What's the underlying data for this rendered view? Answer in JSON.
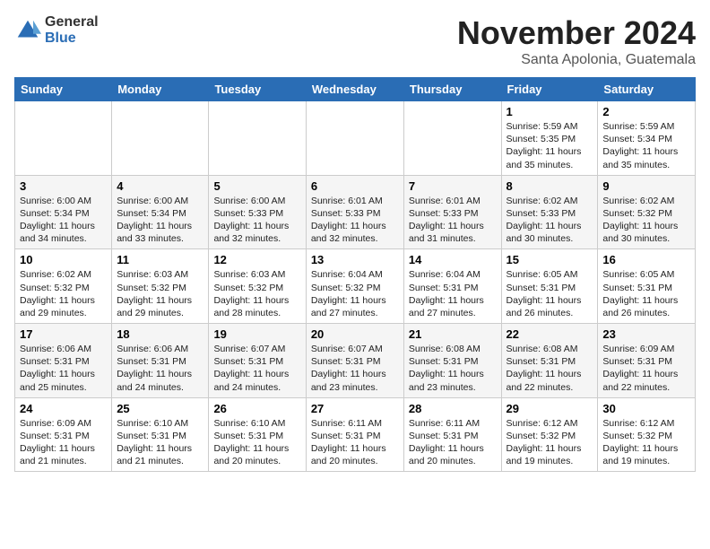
{
  "logo": {
    "general": "General",
    "blue": "Blue"
  },
  "title": "November 2024",
  "location": "Santa Apolonia, Guatemala",
  "weekdays": [
    "Sunday",
    "Monday",
    "Tuesday",
    "Wednesday",
    "Thursday",
    "Friday",
    "Saturday"
  ],
  "weeks": [
    [
      {
        "day": "",
        "info": ""
      },
      {
        "day": "",
        "info": ""
      },
      {
        "day": "",
        "info": ""
      },
      {
        "day": "",
        "info": ""
      },
      {
        "day": "",
        "info": ""
      },
      {
        "day": "1",
        "info": "Sunrise: 5:59 AM\nSunset: 5:35 PM\nDaylight: 11 hours\nand 35 minutes."
      },
      {
        "day": "2",
        "info": "Sunrise: 5:59 AM\nSunset: 5:34 PM\nDaylight: 11 hours\nand 35 minutes."
      }
    ],
    [
      {
        "day": "3",
        "info": "Sunrise: 6:00 AM\nSunset: 5:34 PM\nDaylight: 11 hours\nand 34 minutes."
      },
      {
        "day": "4",
        "info": "Sunrise: 6:00 AM\nSunset: 5:34 PM\nDaylight: 11 hours\nand 33 minutes."
      },
      {
        "day": "5",
        "info": "Sunrise: 6:00 AM\nSunset: 5:33 PM\nDaylight: 11 hours\nand 32 minutes."
      },
      {
        "day": "6",
        "info": "Sunrise: 6:01 AM\nSunset: 5:33 PM\nDaylight: 11 hours\nand 32 minutes."
      },
      {
        "day": "7",
        "info": "Sunrise: 6:01 AM\nSunset: 5:33 PM\nDaylight: 11 hours\nand 31 minutes."
      },
      {
        "day": "8",
        "info": "Sunrise: 6:02 AM\nSunset: 5:33 PM\nDaylight: 11 hours\nand 30 minutes."
      },
      {
        "day": "9",
        "info": "Sunrise: 6:02 AM\nSunset: 5:32 PM\nDaylight: 11 hours\nand 30 minutes."
      }
    ],
    [
      {
        "day": "10",
        "info": "Sunrise: 6:02 AM\nSunset: 5:32 PM\nDaylight: 11 hours\nand 29 minutes."
      },
      {
        "day": "11",
        "info": "Sunrise: 6:03 AM\nSunset: 5:32 PM\nDaylight: 11 hours\nand 29 minutes."
      },
      {
        "day": "12",
        "info": "Sunrise: 6:03 AM\nSunset: 5:32 PM\nDaylight: 11 hours\nand 28 minutes."
      },
      {
        "day": "13",
        "info": "Sunrise: 6:04 AM\nSunset: 5:32 PM\nDaylight: 11 hours\nand 27 minutes."
      },
      {
        "day": "14",
        "info": "Sunrise: 6:04 AM\nSunset: 5:31 PM\nDaylight: 11 hours\nand 27 minutes."
      },
      {
        "day": "15",
        "info": "Sunrise: 6:05 AM\nSunset: 5:31 PM\nDaylight: 11 hours\nand 26 minutes."
      },
      {
        "day": "16",
        "info": "Sunrise: 6:05 AM\nSunset: 5:31 PM\nDaylight: 11 hours\nand 26 minutes."
      }
    ],
    [
      {
        "day": "17",
        "info": "Sunrise: 6:06 AM\nSunset: 5:31 PM\nDaylight: 11 hours\nand 25 minutes."
      },
      {
        "day": "18",
        "info": "Sunrise: 6:06 AM\nSunset: 5:31 PM\nDaylight: 11 hours\nand 24 minutes."
      },
      {
        "day": "19",
        "info": "Sunrise: 6:07 AM\nSunset: 5:31 PM\nDaylight: 11 hours\nand 24 minutes."
      },
      {
        "day": "20",
        "info": "Sunrise: 6:07 AM\nSunset: 5:31 PM\nDaylight: 11 hours\nand 23 minutes."
      },
      {
        "day": "21",
        "info": "Sunrise: 6:08 AM\nSunset: 5:31 PM\nDaylight: 11 hours\nand 23 minutes."
      },
      {
        "day": "22",
        "info": "Sunrise: 6:08 AM\nSunset: 5:31 PM\nDaylight: 11 hours\nand 22 minutes."
      },
      {
        "day": "23",
        "info": "Sunrise: 6:09 AM\nSunset: 5:31 PM\nDaylight: 11 hours\nand 22 minutes."
      }
    ],
    [
      {
        "day": "24",
        "info": "Sunrise: 6:09 AM\nSunset: 5:31 PM\nDaylight: 11 hours\nand 21 minutes."
      },
      {
        "day": "25",
        "info": "Sunrise: 6:10 AM\nSunset: 5:31 PM\nDaylight: 11 hours\nand 21 minutes."
      },
      {
        "day": "26",
        "info": "Sunrise: 6:10 AM\nSunset: 5:31 PM\nDaylight: 11 hours\nand 20 minutes."
      },
      {
        "day": "27",
        "info": "Sunrise: 6:11 AM\nSunset: 5:31 PM\nDaylight: 11 hours\nand 20 minutes."
      },
      {
        "day": "28",
        "info": "Sunrise: 6:11 AM\nSunset: 5:31 PM\nDaylight: 11 hours\nand 20 minutes."
      },
      {
        "day": "29",
        "info": "Sunrise: 6:12 AM\nSunset: 5:32 PM\nDaylight: 11 hours\nand 19 minutes."
      },
      {
        "day": "30",
        "info": "Sunrise: 6:12 AM\nSunset: 5:32 PM\nDaylight: 11 hours\nand 19 minutes."
      }
    ]
  ]
}
